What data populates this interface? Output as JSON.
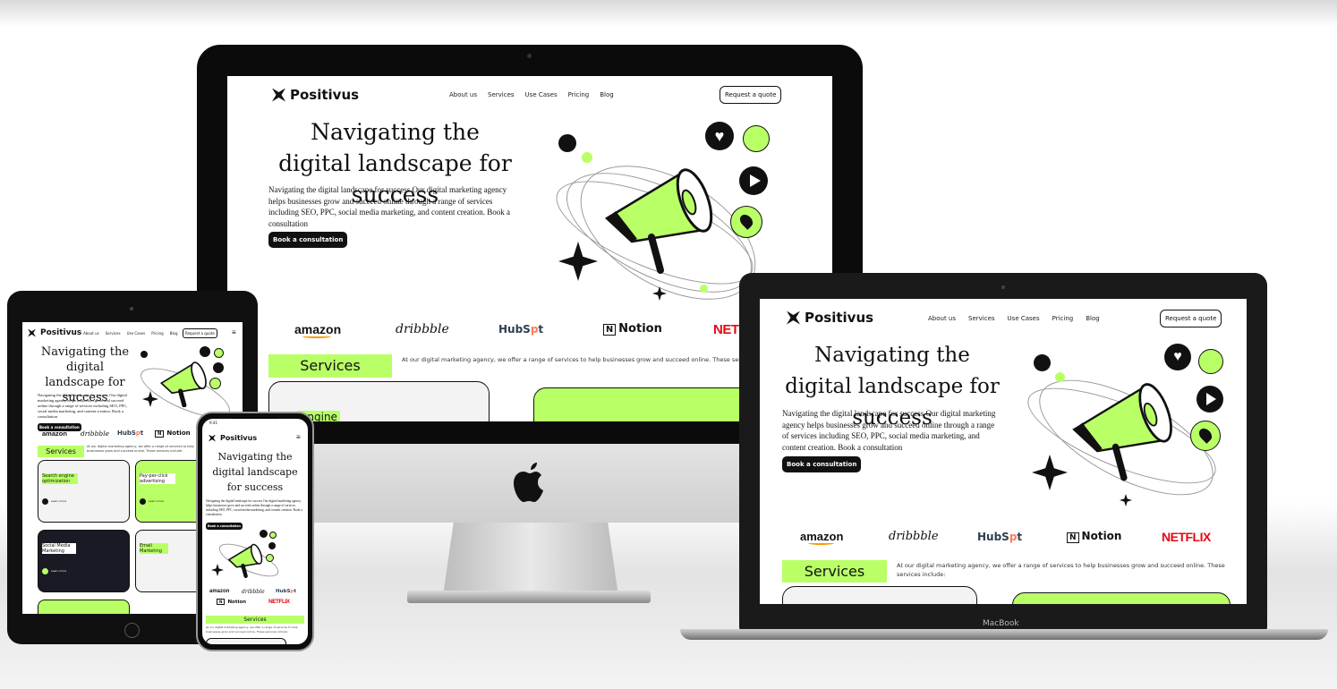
{
  "site": {
    "brand": "Positivus",
    "nav": [
      "About us",
      "Services",
      "Use Cases",
      "Pricing",
      "Blog"
    ],
    "quote_button": "Request a quote",
    "hero_title": "Navigating the digital landscape for success",
    "hero_body": "Navigating the digital landscape for success Our digital marketing agency helps businesses grow and succeed online through a range of services including SEO, PPC, social media marketing, and content creation. Book a consultation",
    "book_button": "Book a consultation",
    "logos": {
      "amazon": "amazon",
      "dribbble": "dribbble",
      "hubspot_pre": "HubS",
      "hubspot_o": "p",
      "hubspot_post": "t",
      "notion": "Notion",
      "notion_mark": "N",
      "netflix": "NETFLIX",
      "netflix_cut": "NETF"
    },
    "services_label": "Services",
    "services_text": "At our digital marketing agency, we offer a range of services to help businesses grow and succeed online. These services include:",
    "services_text_cut": "At our digital marketing agency, we offer a range of services to help businesses grow and succeed online. These services",
    "card_titles": [
      "Search engine optimization",
      "Pay-per-click advertising",
      "Social Media Marketing",
      "Email Marketing"
    ],
    "card_title_cut": "engine",
    "learn_more": "Learn more"
  },
  "devices": {
    "macbook_label": "MacBook",
    "phone_time": "9:41"
  },
  "colors": {
    "accent": "#b9ff66",
    "dark": "#191a23",
    "netflix": "#e50914",
    "hubspot_dot": "#ff7a59",
    "amazon_smile": "#ff9900"
  },
  "icons": [
    "positivus-logo-icon",
    "megaphone-icon",
    "heart-icon",
    "share-icon",
    "play-icon",
    "location-pin-icon",
    "sparkle-star-icon",
    "apple-logo-icon",
    "hamburger-menu-icon",
    "learn-more-arrow-icon"
  ]
}
